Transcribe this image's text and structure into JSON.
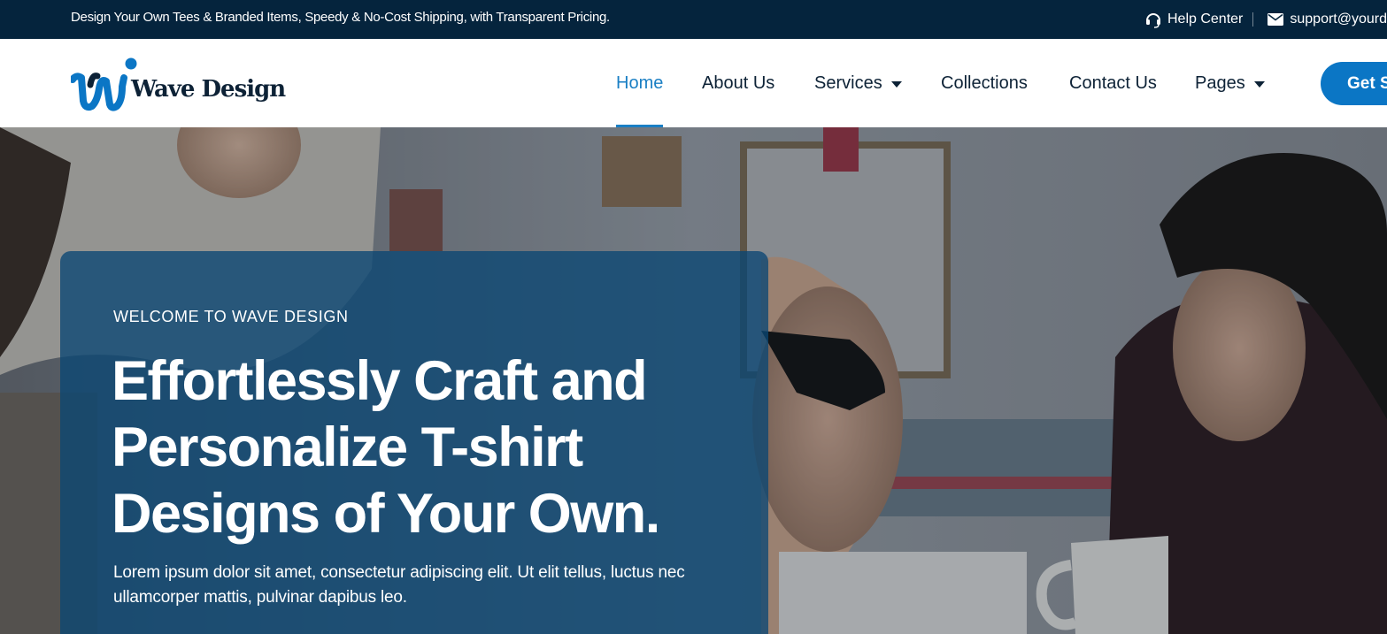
{
  "topbar": {
    "message": "Design Your Own Tees & Branded Items, Speedy & No-Cost Shipping, with Transparent Pricing.",
    "help_label": "Help Center",
    "help_icon": "headset-icon",
    "email_label": "support@yourd",
    "email_icon": "envelope-icon"
  },
  "header": {
    "logo_text": "Wave Design",
    "nav": [
      {
        "label": "Home",
        "active": true
      },
      {
        "label": "About Us"
      },
      {
        "label": "Services",
        "dropdown": true
      },
      {
        "label": "Collections"
      },
      {
        "label": "Contact Us"
      },
      {
        "label": "Pages",
        "dropdown": true
      }
    ],
    "cta_label": "Get St"
  },
  "hero": {
    "eyebrow": "WELCOME TO WAVE DESIGN",
    "headline": "Effortlessly Craft and Personalize T-shirt Designs of Your Own.",
    "lead": "Lorem ipsum dolor sit amet, consectetur adipiscing elit. Ut elit tellus, luctus nec ullamcorper mattis, pulvinar dapibus leo."
  },
  "colors": {
    "topbar_bg": "#05243d",
    "brand_dark": "#0d2236",
    "accent": "#1a7fc4",
    "cta_bg": "#0b76c5",
    "hero_card": "#0a4673"
  }
}
